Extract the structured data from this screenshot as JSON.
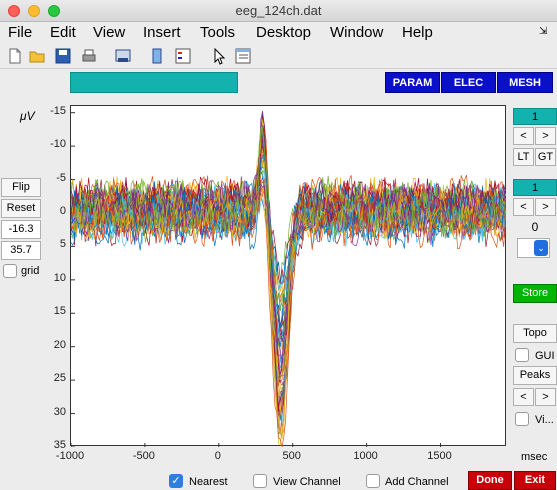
{
  "window": {
    "title": "eeg_124ch.dat"
  },
  "menus": [
    "File",
    "Edit",
    "View",
    "Insert",
    "Tools",
    "Desktop",
    "Window",
    "Help"
  ],
  "header_buttons": {
    "param": "PARAM",
    "elec": "ELEC",
    "mesh": "MESH"
  },
  "left_panel": {
    "unit": "μV",
    "flip": "Flip",
    "reset": "Reset",
    "ymin": "-16.3",
    "ymax": "35.7",
    "grid_label": "grid"
  },
  "right_panel": {
    "chan1": "1",
    "prev": "<",
    "next": ">",
    "lt": "LT",
    "gt": "GT",
    "chan2": "1",
    "prev2": "<",
    "next2": ">",
    "value": "0",
    "store": "Store",
    "topo": "Topo",
    "gui": "GUI",
    "peaks": "Peaks",
    "prev3": "<",
    "next3": ">",
    "vi": "Vi..."
  },
  "bottom": {
    "xunit": "msec",
    "nearest": "Nearest",
    "view_channel": "View Channel",
    "add_channel": "Add Channel",
    "done": "Done",
    "exit": "Exit"
  },
  "colors": {
    "accent_teal": "#13b2ae",
    "blue_button": "#0a10c8",
    "store_green": "#00b400",
    "done_red": "#c8000a"
  },
  "chart_data": {
    "type": "line",
    "xlabel": "msec",
    "ylabel": "μV",
    "xlim": [
      -1000,
      1950
    ],
    "ylim": [
      -16,
      35
    ],
    "y_reversed": true,
    "xticks": [
      "-1000",
      "-500",
      "0",
      "500",
      "1000",
      "1500"
    ],
    "yticks": [
      "-15",
      "-10",
      "-5",
      "0",
      "5",
      "10",
      "15",
      "20",
      "25",
      "30",
      "35"
    ],
    "series_count": 40,
    "peak_negative": {
      "x": 300,
      "y": -16
    },
    "peak_positive": {
      "x": 420,
      "y": 35
    }
  }
}
